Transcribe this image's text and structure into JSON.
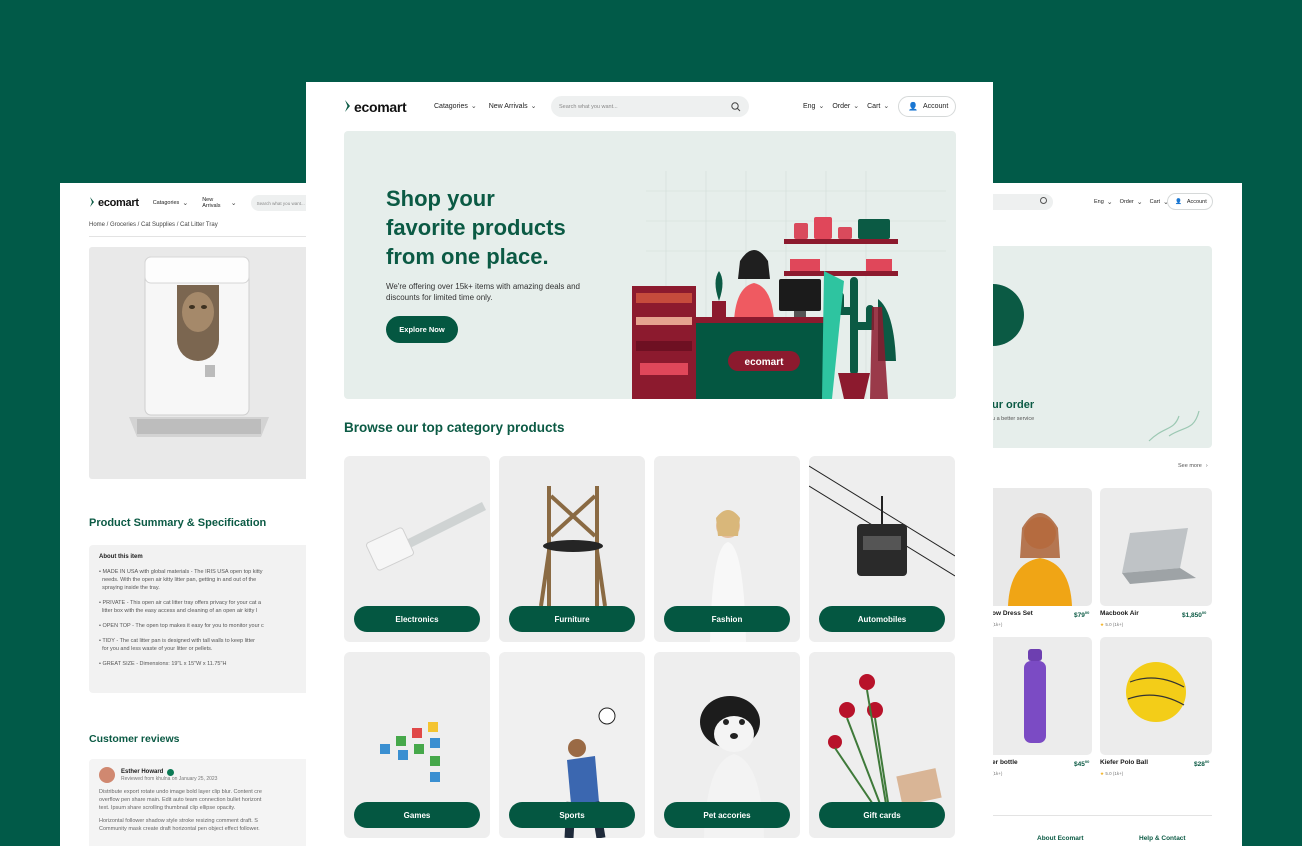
{
  "brand": {
    "name": "ecomart",
    "primary": "#045741",
    "bg": "#015a48",
    "hero_bg": "#e6eeeb"
  },
  "main_header": {
    "nav": [
      {
        "label": "Catagories"
      },
      {
        "label": "New Arrivals"
      }
    ],
    "search_placeholder": "Search what you want...",
    "right": [
      {
        "label": "Eng"
      },
      {
        "label": "Order"
      },
      {
        "label": "Cart"
      }
    ],
    "account_label": "Account"
  },
  "hero": {
    "title_lines": [
      "Shop your",
      "favorite products",
      "from one place."
    ],
    "subtitle_lines": [
      "We're offering over 15k+ items with amazing deals and",
      "discounts for limited time only."
    ],
    "cta_label": "Explore Now",
    "counter_logo": "ecomart"
  },
  "categories_section": {
    "title": "Browse our top category products",
    "items": [
      {
        "label": "Electronics",
        "icon": "cable-icon"
      },
      {
        "label": "Furniture",
        "icon": "chair-icon"
      },
      {
        "label": "Fashion",
        "icon": "model-icon"
      },
      {
        "label": "Automobiles",
        "icon": "cable-car-icon"
      },
      {
        "label": "Games",
        "icon": "game-pieces-icon"
      },
      {
        "label": "Sports",
        "icon": "soccer-player-icon"
      },
      {
        "label": "Pet accories",
        "icon": "puppy-icon"
      },
      {
        "label": "Gift cards",
        "icon": "roses-icon"
      }
    ]
  },
  "left_page": {
    "nav": [
      {
        "label": "Catagories"
      },
      {
        "label": "New Arrivals"
      }
    ],
    "search_placeholder": "Search what you want...",
    "breadcrumb": "Home / Groceries / Cat Supplies / Cat Litter Tray",
    "summary_title": "Product Summary & Specification",
    "about_title": "About this item",
    "bullets": [
      "MADE IN USA with global materials - The IRIS USA open top kitty",
      "needs. With the open air kitty litter pan, getting in and out of the",
      "spraying inside the tray.",
      "PRIVATE - This open air cat litter tray offers privacy for your cat a",
      "litter box with the easy access and cleaning of an open air kitty l",
      "OPEN TOP - The open top makes it easy for you to monitor your c",
      "TIDY - The cat litter pan is designed with tall walls to keep litter",
      "for you and less waste of your litter or pellets.",
      "GREAT SIZE - Dimensions: 19\"L x 15\"W x 11.75\"H"
    ],
    "reviews_title": "Customer reviews",
    "review": {
      "name": "Esther Howard",
      "meta": "Reviewed from khulna on January 25, 2023",
      "lines": [
        "Distribute export rotate undo image bold layer clip blur. Content cre",
        "overflow pen share main. Edit auto team connection bullet horizont",
        "text. Ipsum share scrolling thumbnail clip ellipse opacity.",
        "Horizontal follower shadow style stroke resizing comment draft. S",
        "Community mask create draft horizontal pen object effect follower."
      ]
    }
  },
  "right_page": {
    "right": [
      {
        "label": "Eng"
      },
      {
        "label": "Order"
      },
      {
        "label": "Cart"
      }
    ],
    "account_label": "Account",
    "banner_title": "ur order",
    "banner_sub": "u a better service",
    "see_more": "See more",
    "products": [
      {
        "name": "ow Dress Set",
        "price": "$79",
        "cents": "00",
        "rating": "(1k+)"
      },
      {
        "name": "Macbook Air",
        "price": "$1,850",
        "cents": "00",
        "rating": "5.0 (1k+)"
      },
      {
        "name": "er bottle",
        "price": "$45",
        "cents": "00",
        "rating": "(1k+)"
      },
      {
        "name": "Kiefer Polo Ball",
        "price": "$28",
        "cents": "00",
        "rating": "5.0 (1k+)"
      }
    ],
    "footer": [
      {
        "label": "About Ecomart"
      },
      {
        "label": "Help & Contact"
      }
    ]
  }
}
